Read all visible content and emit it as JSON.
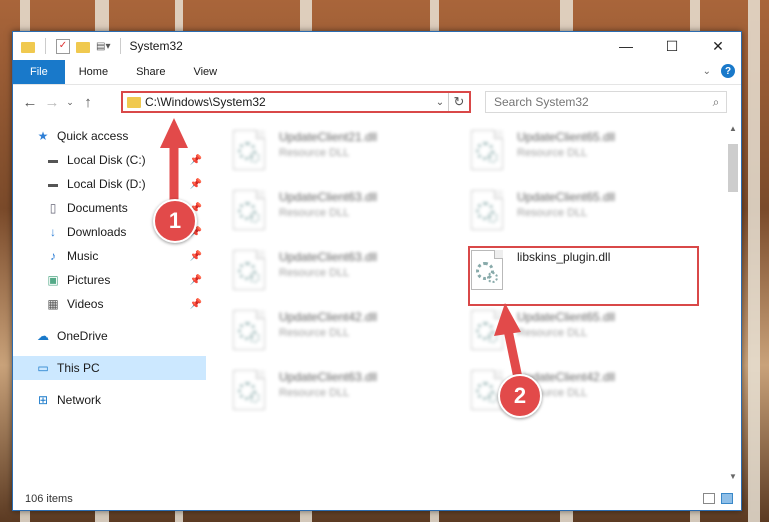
{
  "window": {
    "title": "System32",
    "controls": {
      "minimize": "—",
      "maximize": "☐",
      "close": "✕"
    }
  },
  "ribbon": {
    "tabs": [
      "File",
      "Home",
      "Share",
      "View"
    ]
  },
  "nav": {
    "address": "C:\\Windows\\System32",
    "search_placeholder": "Search System32"
  },
  "sidebar": {
    "quick_access": "Quick access",
    "items": [
      {
        "label": "Local Disk (C:)",
        "icon": "drive-icon"
      },
      {
        "label": "Local Disk (D:)",
        "icon": "drive-icon"
      },
      {
        "label": "Documents",
        "icon": "documents-icon"
      },
      {
        "label": "Downloads",
        "icon": "downloads-icon"
      },
      {
        "label": "Music",
        "icon": "music-icon"
      },
      {
        "label": "Pictures",
        "icon": "pictures-icon"
      },
      {
        "label": "Videos",
        "icon": "videos-icon"
      }
    ],
    "onedrive": "OneDrive",
    "this_pc": "This PC",
    "network": "Network"
  },
  "files": {
    "left": [
      {
        "name": "UpdateClient21.dll",
        "type": "Resource DLL"
      },
      {
        "name": "UpdateClient63.dll",
        "type": "Resource DLL"
      },
      {
        "name": "UpdateClient63.dll",
        "type": "Resource DLL"
      },
      {
        "name": "UpdateClient42.dll",
        "type": "Resource DLL"
      },
      {
        "name": "UpdateClient63.dll",
        "type": "Resource DLL"
      }
    ],
    "right": [
      {
        "name": "UpdateClient65.dll",
        "type": "Resource DLL"
      },
      {
        "name": "UpdateClient65.dll",
        "type": "Resource DLL"
      },
      {
        "name": "libskins_plugin.dll",
        "type": ""
      },
      {
        "name": "UpdateClient65.dll",
        "type": "Resource DLL"
      },
      {
        "name": "UpdateClient42.dll",
        "type": "Resource DLL"
      }
    ]
  },
  "status": {
    "count": "106 items"
  },
  "callouts": {
    "one": "1",
    "two": "2"
  },
  "colors": {
    "accent": "#1979ca",
    "highlight": "#d94848"
  }
}
